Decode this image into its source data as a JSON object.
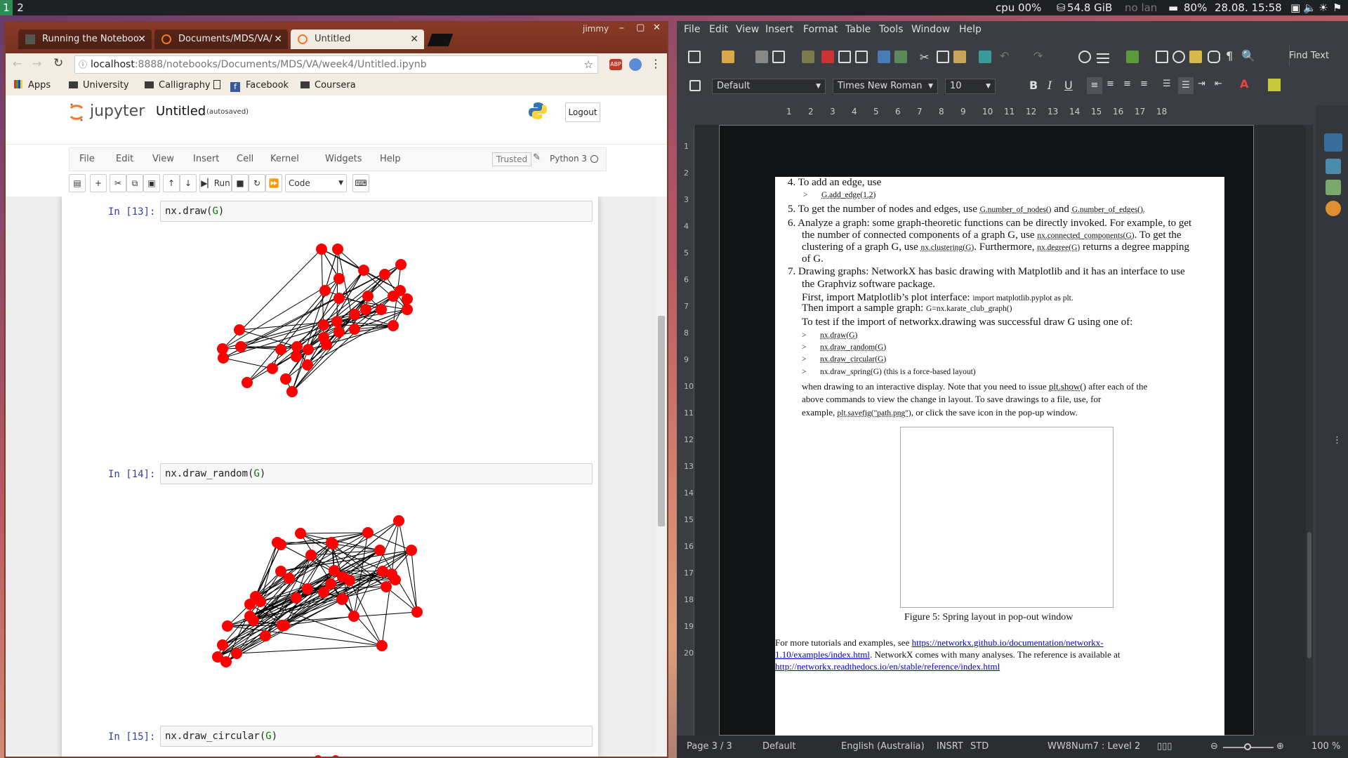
{
  "topbar": {
    "workspaces": [
      "1",
      "2"
    ],
    "cpu": "cpu  00%",
    "disk": "54.8 GiB",
    "network": "no lan",
    "battery": "80%",
    "datetime": "28.08. 15:58"
  },
  "browser": {
    "user": "jimmy",
    "tabs": [
      {
        "label": "Running the Noteboo"
      },
      {
        "label": "Documents/MDS/VA/"
      },
      {
        "label": "Untitled"
      }
    ],
    "url_host": "localhost",
    "url_path": ":8888/notebooks/Documents/MDS/VA/week4/Untitled.ipynb",
    "bookmarks": [
      "Apps",
      "University",
      "Calligraphy",
      "Facebook",
      "Coursera"
    ]
  },
  "jupyter": {
    "logo": "jupyter",
    "notebook_name": "Untitled",
    "autosave": "(autosaved)",
    "logout": "Logout",
    "menu": [
      "File",
      "Edit",
      "View",
      "Insert",
      "Cell",
      "Kernel",
      "Widgets",
      "Help"
    ],
    "trusted": "Trusted",
    "kernel": "Python 3",
    "run_label": "Run",
    "cell_type": "Code",
    "cells": [
      {
        "prompt": "In [13]:",
        "fn": "nx.draw",
        "arg": "G"
      },
      {
        "prompt": "In [14]:",
        "fn": "nx.draw_random",
        "arg": "G"
      },
      {
        "prompt": "In [15]:",
        "fn": "nx.draw_circular",
        "arg": "G"
      }
    ]
  },
  "writer": {
    "menu": [
      "File",
      "Edit",
      "View",
      "Insert",
      "Format",
      "Table",
      "Tools",
      "Window",
      "Help"
    ],
    "find_text": "Find Text",
    "para_style": "Default",
    "font_name": "Times New Roman",
    "font_size": "10",
    "ruler_ticks": [
      "1",
      "2",
      "3",
      "4",
      "5",
      "6",
      "7",
      "8",
      "9",
      "10",
      "11",
      "12",
      "13",
      "14",
      "15",
      "16",
      "17",
      "18"
    ],
    "vruler_ticks": [
      "1",
      "2",
      "3",
      "4",
      "5",
      "6",
      "7",
      "8",
      "9",
      "10",
      "11",
      "12",
      "13",
      "14",
      "15",
      "16",
      "17",
      "18",
      "19",
      "20"
    ],
    "doc": {
      "l1": "4. To add an edge, use",
      "l1b": ">",
      "l1c": "G.add_edge(1,2)",
      "l2a": "5. To get the number of nodes and edges, use ",
      "l2b": "G.number_of_nodes()",
      "l2c": " and ",
      "l2d": "G.number_of_edges().",
      "l3": "6. Analyze a graph: some graph-theoretic functions can be directly invoked. For example, to get",
      "l4a": "the number of connected components of a graph G, use ",
      "l4b": "nx.connected_components(G)",
      "l4c": ". To get the",
      "l5a": "clustering of a graph G, use ",
      "l5b": "nx.clustering(G)",
      "l5c": ". Furthermore, ",
      "l5d": "nx.degree(G)",
      "l5e": " returns a degree mapping",
      "l6": "of G.",
      "l7": "7. Drawing graphs: NetworkX has basic drawing with Matplotlib and it has an interface to use",
      "l8": "the Graphviz software package.",
      "l9a": "First, import Matplotlib’s plot interface: ",
      "l9b": "import matplotlib.pyplot as plt.",
      "l10a": "Then import a sample graph: ",
      "l10b": "G=nx.karate_club_graph()",
      "l11": "To test if the import of networkx.drawing was successful draw G using one of:",
      "bullets": [
        "nx.draw(G)",
        "nx.draw_random(G)",
        "nx.draw_circular(G)",
        "nx.draw_spring(G) (this is a force-based layout)"
      ],
      "bullet_marker": ">",
      "l12a": "when drawing to an interactive display. Note that you need to issue ",
      "l12b": "plt.show()",
      "l12c": " after each of the",
      "l13": "above commands to view the change in layout. To save drawings to a file, use, for",
      "l14a": "example, ",
      "l14b": "plt.savefig(\"path.png\")",
      "l14c": ", or click the save icon in the pop-up window.",
      "caption": "Figure  5: Spring layout in pop-out window",
      "l15a": "For more tutorials and examples, see ",
      "l15b": "https://networkx.github.io/documentation/networkx-",
      "l16a": "1.10/examples/index.html",
      "l16b": ". NetworkX comes with many analyses. The reference is available at",
      "l17": "http://networkx.readthedocs.io/en/stable/reference/index.html"
    },
    "status": {
      "page": "Page 3 / 3",
      "style": "Default",
      "lang": "English (Australia)",
      "mode": "INSRT",
      "sel": "STD",
      "level": "WW8Num7 : Level 2",
      "zoom": "100 %"
    }
  },
  "colors": {
    "node": "#ff0000",
    "jupyter_orange": "#f37626",
    "link": "#0000cc"
  }
}
